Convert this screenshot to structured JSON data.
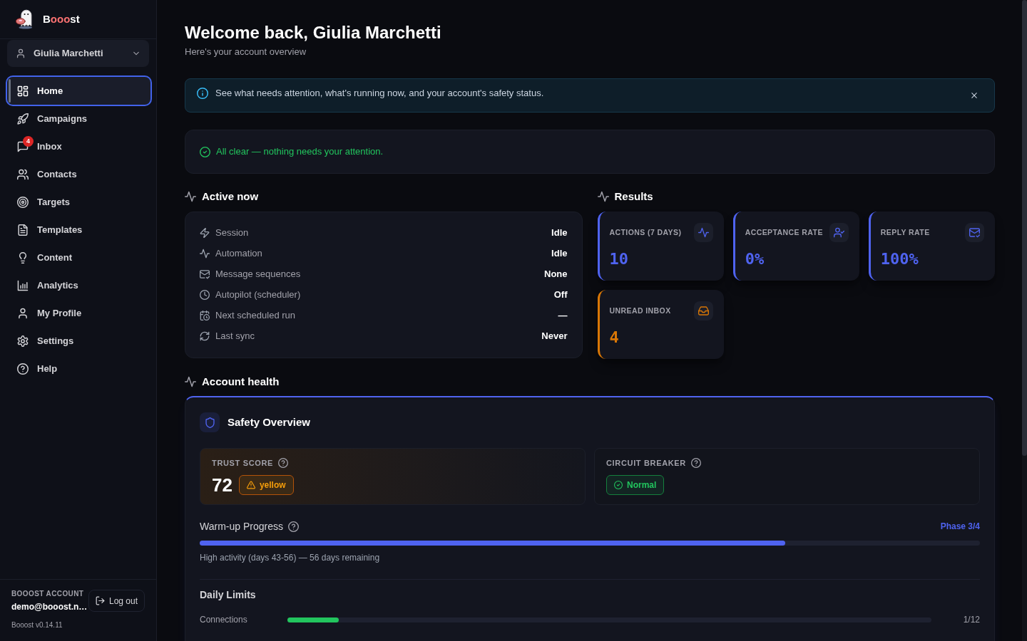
{
  "sidebar": {
    "logo": [
      {
        "text": "B",
        "color": "#ffffff"
      },
      {
        "text": "ooo",
        "color": "#f87171"
      },
      {
        "text": "st",
        "color": "#ffffff"
      }
    ],
    "profile_selector": {
      "name": "Giulia Marchetti"
    },
    "nav": [
      {
        "label": "Home",
        "selected": true
      },
      {
        "label": "Campaigns",
        "selected": false
      },
      {
        "label": "Inbox",
        "selected": false,
        "badge": "4"
      },
      {
        "label": "Contacts",
        "selected": false
      },
      {
        "label": "Targets",
        "selected": false
      },
      {
        "label": "Templates",
        "selected": false
      },
      {
        "label": "Content",
        "selected": false
      },
      {
        "label": "Analytics",
        "selected": false
      },
      {
        "label": "My Profile",
        "selected": false
      },
      {
        "label": "Settings",
        "selected": false
      },
      {
        "label": "Help",
        "selected": false
      }
    ],
    "account": {
      "label": "BOOOST ACCOUNT",
      "email": "demo@booost.n…",
      "logout": "Log out",
      "version": "Booost v0.14.11"
    }
  },
  "header": {
    "title": "Welcome back, Giulia Marchetti",
    "subtitle": "Here's your account overview"
  },
  "info_banner": {
    "text": "See what needs attention, what's running now, and your account's safety status."
  },
  "attention": {
    "text": "All clear — nothing needs your attention."
  },
  "active_now": {
    "title": "Active now",
    "rows": [
      {
        "label": "Session",
        "value": "Idle"
      },
      {
        "label": "Automation",
        "value": "Idle"
      },
      {
        "label": "Message sequences",
        "value": "None"
      },
      {
        "label": "Autopilot (scheduler)",
        "value": "Off"
      },
      {
        "label": "Next scheduled run",
        "value": "—"
      },
      {
        "label": "Last sync",
        "value": "Never"
      }
    ]
  },
  "results": {
    "title": "Results",
    "cards": [
      {
        "label": "ACTIONS (7 DAYS)",
        "value": "10",
        "color": "#4f63f0"
      },
      {
        "label": "ACCEPTANCE RATE",
        "value": "0%",
        "color": "#4f63f0"
      },
      {
        "label": "REPLY RATE",
        "value": "100%",
        "color": "#4f63f0"
      },
      {
        "label": "UNREAD INBOX",
        "value": "4",
        "color": "#d97706"
      }
    ]
  },
  "account_health": {
    "title": "Account health",
    "safety": {
      "title": "Safety Overview",
      "panels": [
        {
          "label": "TRUST SCORE",
          "score": "72",
          "badge": {
            "text": "yellow",
            "kind": "warning"
          }
        },
        {
          "label": "CIRCUIT BREAKER",
          "badge": {
            "text": "Normal",
            "kind": "ok"
          }
        }
      ],
      "warmup": {
        "title": "Warm-up Progress",
        "phase": "Phase 3/4",
        "level": 0.75,
        "note": "High activity (days 43-56) — 56 days remaining"
      },
      "daily_limits": {
        "title": "Daily Limits",
        "rows": [
          {
            "label": "Connections",
            "level": 0.08,
            "reading": "1/12"
          }
        ]
      }
    }
  }
}
